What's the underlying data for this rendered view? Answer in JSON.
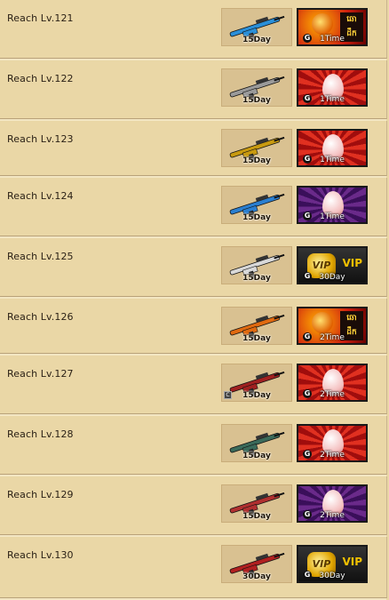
{
  "rows": [
    {
      "label": "Reach Lv.121",
      "weapon": "blue-sniper-rifle-icon",
      "weapon_duration": "15Day",
      "reward": "khmer-mystery-box-icon",
      "reward_duration": "1Time",
      "weapon_color": "#2a8fd8",
      "reward_bg": "#c33"
    },
    {
      "label": "Reach Lv.122",
      "weapon": "silver-crossbow-icon",
      "weapon_duration": "15Day",
      "reward": "egg-box-red-icon",
      "reward_duration": "1Time",
      "weapon_color": "#9a9a9a",
      "reward_bg": "#c11"
    },
    {
      "label": "Reach Lv.123",
      "weapon": "gold-grenade-icon",
      "weapon_duration": "15Day",
      "reward": "egg-box-red-icon",
      "reward_duration": "1Time",
      "weapon_color": "#c89a10",
      "reward_bg": "#c11"
    },
    {
      "label": "Reach Lv.124",
      "weapon": "blue-camo-smg-icon",
      "weapon_duration": "15Day",
      "reward": "egg-box-purple-icon",
      "reward_duration": "1Time",
      "weapon_color": "#2b7fd0",
      "reward_bg": "#5a1a7a"
    },
    {
      "label": "Reach Lv.125",
      "weapon": "white-smg-icon",
      "weapon_duration": "15Day",
      "reward": "vip-card-icon",
      "reward_duration": "30Day",
      "weapon_color": "#d8d8d8",
      "reward_bg": "#222"
    },
    {
      "label": "Reach Lv.126",
      "weapon": "flame-rifle-icon",
      "weapon_duration": "15Day",
      "reward": "khmer-mystery-box-icon",
      "reward_duration": "2Time",
      "weapon_color": "#e06a10",
      "reward_bg": "#c33"
    },
    {
      "label": "Reach Lv.127",
      "weapon": "red-assault-rifle-icon",
      "weapon_duration": "15Day",
      "reward": "egg-box-red-icon",
      "reward_duration": "2Time",
      "weapon_color": "#a02020",
      "reward_bg": "#c11"
    },
    {
      "label": "Reach Lv.128",
      "weapon": "green-launcher-icon",
      "weapon_duration": "15Day",
      "reward": "egg-box-red-icon",
      "reward_duration": "2Time",
      "weapon_color": "#3a6a5a",
      "reward_bg": "#c11"
    },
    {
      "label": "Reach Lv.129",
      "weapon": "red-sniper-rifle-icon",
      "weapon_duration": "15Day",
      "reward": "egg-box-purple-icon",
      "reward_duration": "2Time",
      "weapon_color": "#b03030",
      "reward_bg": "#5a1a7a"
    },
    {
      "label": "Reach Lv.130",
      "weapon": "red-black-rifle-icon",
      "weapon_duration": "30Day",
      "reward": "vip-card-icon",
      "reward_duration": "30Day",
      "weapon_color": "#b02020",
      "reward_bg": "#222"
    }
  ],
  "texts": {
    "khmer_box": "ឆោ\nដឹក",
    "vip": "VIP",
    "vip_badge": "VIP",
    "g": "G",
    "small_badge": "C"
  }
}
